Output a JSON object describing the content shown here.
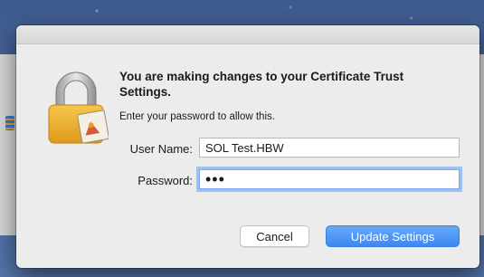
{
  "dialog": {
    "heading": "You are making changes to your Certificate Trust Settings.",
    "subtext": "Enter your password to allow this."
  },
  "form": {
    "username_label": "User Name:",
    "username_value": "SOL Test.HBW",
    "password_label": "Password:",
    "password_value": "•••"
  },
  "buttons": {
    "cancel": "Cancel",
    "update": "Update Settings"
  },
  "colors": {
    "accent": "#3c87f0",
    "focus_ring": "#9ec1f3",
    "desktop": "#4c6aa0"
  },
  "icons": {
    "lock": "padlock-with-certificate-icon"
  }
}
